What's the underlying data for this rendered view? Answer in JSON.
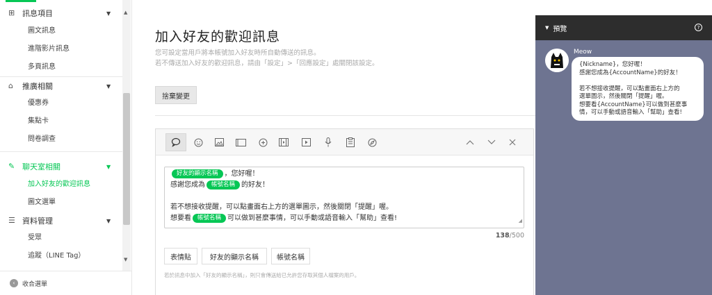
{
  "sidebar": {
    "sections": [
      {
        "label": "訊息項目",
        "icon": "plus-square-icon"
      },
      {
        "label": "推廣相關",
        "icon": "shop-icon"
      },
      {
        "label": "聊天室相關",
        "icon": "chat-edit-icon"
      },
      {
        "label": "資料管理",
        "icon": "database-icon"
      }
    ],
    "items": {
      "messages": [
        "圖文訊息",
        "進階影片訊息",
        "多頁訊息"
      ],
      "promotion": [
        "優惠券",
        "集點卡",
        "問卷調查"
      ],
      "chat": [
        "加入好友的歡迎訊息",
        "圖文選單"
      ],
      "data": [
        "受眾",
        "追蹤（LINE Tag）"
      ]
    },
    "collapse_label": "收合選單",
    "accent_color": "#06c755"
  },
  "main": {
    "title": "加入好友的歡迎訊息",
    "desc_line1": "您可設定當用戶將本帳號加入好友時所自動傳送的訊息。",
    "desc_line2": "若不傳送加入好友的歡迎訊息，請由「設定」>「回應設定」處關閉該設定。",
    "cancel_button": "捨棄變更",
    "toolbar_icons": [
      "text-bubble-icon",
      "emoji-icon",
      "image-icon",
      "card-icon",
      "sticker-icon",
      "video-card-icon",
      "play-icon",
      "mic-icon",
      "coupon-icon",
      "compass-icon",
      "chevron-up-icon",
      "chevron-down-icon",
      "close-icon"
    ],
    "message": {
      "line1_tag": "好友的顯示名稱",
      "line1_text": "，您好喔！",
      "line2_pre": "感謝您成為",
      "line2_tag": "帳號名稱",
      "line2_post": "的好友！",
      "line4": "若不想接收提醒，可以點畫面右上方的選單圖示，然後關閉「提醒」喔。",
      "line5_pre": "想要看",
      "line5_tag": "帳號名稱",
      "line5_post": "可以做到甚麼事情，可以手動或語音輸入「幫助」查看!"
    },
    "counter_current": "138",
    "counter_max": "/500",
    "insert_buttons": [
      "表情貼",
      "好友的顯示名稱",
      "帳號名稱"
    ],
    "hint": "若於訊息中加入「好友的顯示名稱」，則只會傳送給已允許您存取其個人檔案的用戶。"
  },
  "preview": {
    "title": "預覽",
    "sender": "Meow",
    "lines": [
      "{Nickname}，您好喔！",
      "感謝您成為{AccountName}的好友！",
      "",
      "若不想接收提醒，可以點畫面右上方的",
      "選單圖示，然後關閉「提醒」喔。",
      "想要看{AccountName}可以做到甚麼事",
      "情，可以手動或語音輸入「幫助」查看!"
    ],
    "bg_color": "#6e7491"
  }
}
